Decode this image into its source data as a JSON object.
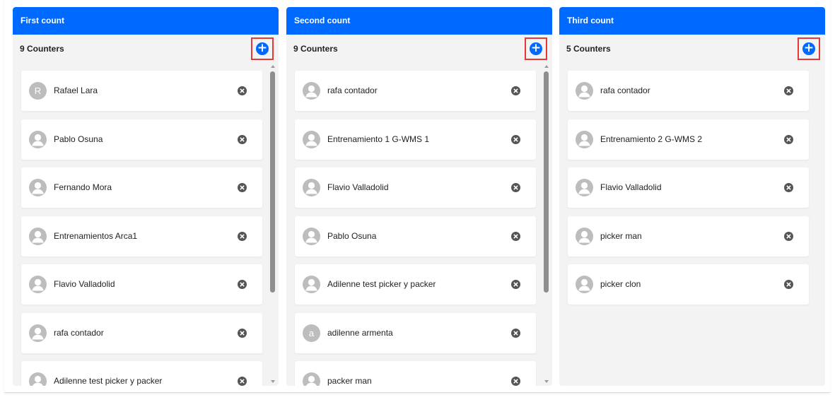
{
  "columns": [
    {
      "title": "First count",
      "subtitle": "9 Counters",
      "add_icon": "plus-circle-icon",
      "remove_icon": "x-circle-icon",
      "has_scrollbar": true,
      "counters": [
        {
          "name": "Rafael Lara",
          "avatar_letter": "R"
        },
        {
          "name": "Pablo Osuna",
          "avatar_letter": ""
        },
        {
          "name": "Fernando Mora",
          "avatar_letter": ""
        },
        {
          "name": "Entrenamientos Arca1",
          "avatar_letter": ""
        },
        {
          "name": "Flavio Valladolid",
          "avatar_letter": ""
        },
        {
          "name": "rafa contador",
          "avatar_letter": ""
        },
        {
          "name": "Adilenne test picker y packer",
          "avatar_letter": ""
        }
      ]
    },
    {
      "title": "Second count",
      "subtitle": "9 Counters",
      "add_icon": "plus-circle-icon",
      "remove_icon": "x-circle-icon",
      "has_scrollbar": true,
      "counters": [
        {
          "name": "rafa contador",
          "avatar_letter": ""
        },
        {
          "name": "Entrenamiento 1 G-WMS 1",
          "avatar_letter": ""
        },
        {
          "name": "Flavio Valladolid",
          "avatar_letter": ""
        },
        {
          "name": "Pablo Osuna",
          "avatar_letter": ""
        },
        {
          "name": "Adilenne test picker y packer",
          "avatar_letter": ""
        },
        {
          "name": "adilenne armenta",
          "avatar_letter": "a"
        },
        {
          "name": "packer man",
          "avatar_letter": ""
        }
      ]
    },
    {
      "title": "Third count",
      "subtitle": "5 Counters",
      "add_icon": "plus-circle-icon",
      "remove_icon": "x-circle-icon",
      "has_scrollbar": false,
      "counters": [
        {
          "name": "rafa contador",
          "avatar_letter": ""
        },
        {
          "name": "Entrenamiento 2 G-WMS 2",
          "avatar_letter": ""
        },
        {
          "name": "Flavio Valladolid",
          "avatar_letter": ""
        },
        {
          "name": "picker man",
          "avatar_letter": ""
        },
        {
          "name": "picker clon",
          "avatar_letter": ""
        }
      ]
    }
  ],
  "colors": {
    "header_blue": "#0069ff",
    "highlight_red": "#e53935",
    "column_bg": "#f3f3f3",
    "avatar_gray": "#bdbdbd"
  }
}
